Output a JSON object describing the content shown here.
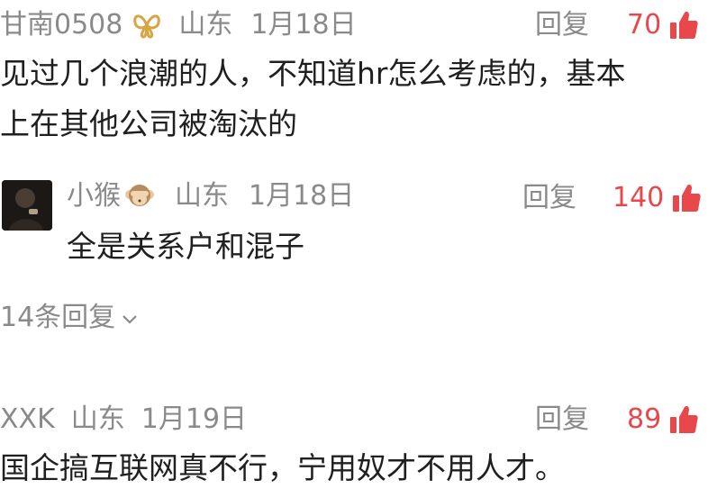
{
  "comments": [
    {
      "username": "甘南0508",
      "badge_icon": "butterfly-badge-icon",
      "location": "山东",
      "date": "1月18日",
      "reply_label": "回复",
      "likes": "70",
      "text_line1": "见过几个浪潮的人，不知道hr怎么考虑的，基本",
      "text_line2": "上在其他公司被淘汰的",
      "accent": "#e8474b"
    },
    {
      "username": "小猴",
      "badge_icon": "monkey-emoji-icon",
      "location": "山东",
      "date": "1月18日",
      "reply_label": "回复",
      "likes": "140",
      "text": "全是关系户和混子"
    },
    {
      "username": "XXK",
      "location": "山东",
      "date": "1月19日",
      "reply_label": "回复",
      "likes": "89",
      "text": "国企搞互联网真不行，宁用奴才不用人才。"
    }
  ],
  "more_replies": {
    "label": "14条回复",
    "icon": "chevron-down-icon"
  }
}
